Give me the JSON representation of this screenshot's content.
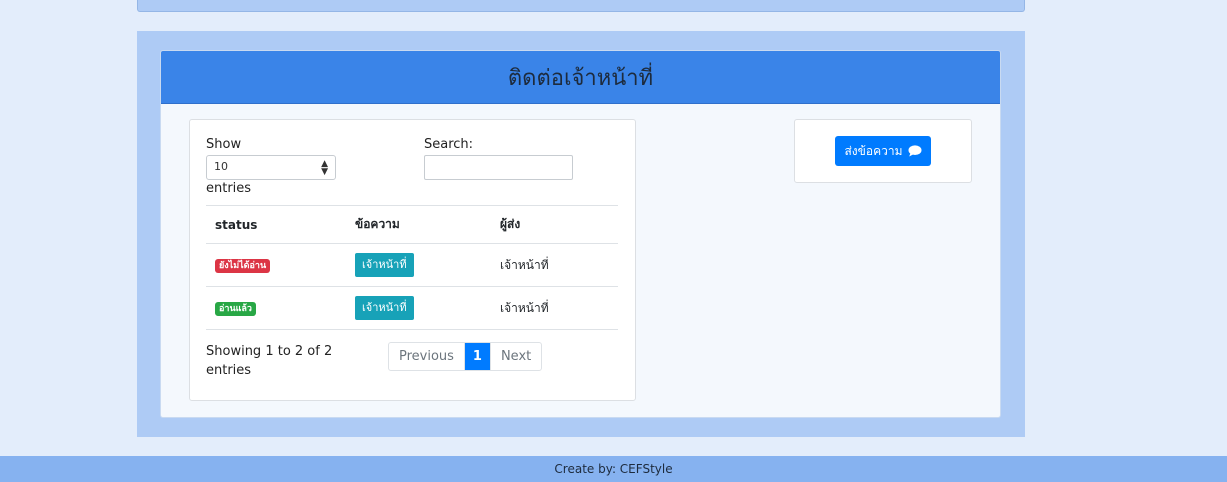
{
  "header": {
    "title": "ติดต่อเจ้าหน้าที่"
  },
  "table_controls": {
    "show_label": "Show",
    "page_size": "10",
    "entries_label": "entries",
    "search_label": "Search:",
    "search_value": ""
  },
  "table": {
    "columns": [
      "status",
      "ข้อความ",
      "ผู้ส่ง"
    ],
    "rows": [
      {
        "status": "ยังไม่ได้อ่าน",
        "status_color": "#dc3545",
        "message_button": "เจ้าหน้าที่",
        "sender": "เจ้าหน้าที่"
      },
      {
        "status": "อ่านแล้ว",
        "status_color": "#28a745",
        "message_button": "เจ้าหน้าที่",
        "sender": "เจ้าหน้าที่"
      }
    ]
  },
  "table_info": "Showing 1 to 2 of 2 entries",
  "pagination": {
    "previous": "Previous",
    "current": "1",
    "next": "Next"
  },
  "send_button": {
    "label": "ส่งข้อความ",
    "icon": "comment-icon"
  },
  "footer": {
    "text": "Create by: CEFStyle"
  },
  "colors": {
    "background": "#e3edfb",
    "panel": "#aecbf5",
    "header": "#3a84e8",
    "primary": "#007bff",
    "info": "#17a2b8",
    "footer": "#86b2f0"
  }
}
